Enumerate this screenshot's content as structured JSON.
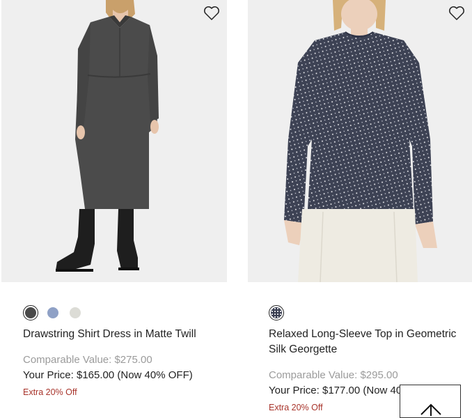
{
  "products": [
    {
      "name": "Drawstring Shirt Dress in Matte Twill",
      "comparable": "Comparable Value: $275.00",
      "price": "Your Price: $165.00 (Now 40% OFF)",
      "extra": "Extra 20% Off",
      "swatches": [
        "#4a4a4a",
        "#8fa1c6",
        "#dcdcd6"
      ],
      "wishlist_icon": "heart-outline-icon"
    },
    {
      "name": "Relaxed Long-Sleeve Top in Geometric Silk Georgette",
      "comparable": "Comparable Value: $295.00",
      "price": "Your Price: $177.00 (Now 40% OFF)",
      "extra": "Extra 20% Off",
      "swatches": [
        "#3a3f52"
      ],
      "wishlist_icon": "heart-outline-icon"
    }
  ],
  "back_to_top_icon": "arrow-up-icon",
  "colors": {
    "image_bg": "#efefef",
    "extra_red": "#a8342b",
    "muted_gray": "#9b9b9b"
  }
}
